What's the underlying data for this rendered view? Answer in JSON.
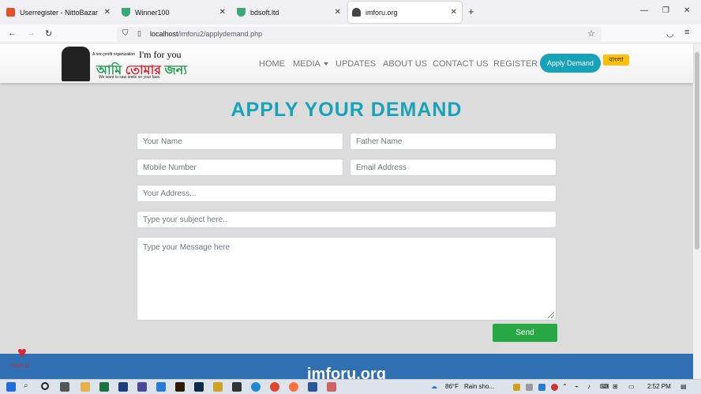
{
  "browser": {
    "tabs": [
      {
        "title": "Userregister - NittoBazar",
        "favicon_color": "#e3512b"
      },
      {
        "title": "Winner100",
        "favicon_color": "#3aa87a"
      },
      {
        "title": "bdsoft.ltd",
        "favicon_color": "#3aa87a"
      },
      {
        "title": "imforu.org",
        "favicon_color": "#444444"
      }
    ],
    "url_host": "localhost",
    "url_path": "/imforu2/applydemand.php"
  },
  "site": {
    "logo": {
      "tagline": "A non profit organization",
      "english": "I'm for you",
      "bangla_part1": "আমি ",
      "bangla_part2": "তোমার",
      "bangla_part3": " জন্য",
      "slogan": "We want to saw smile on your face."
    },
    "nav": [
      "HOME",
      "MEDIA",
      "UPDATES",
      "ABOUT US",
      "CONTACT US",
      "REGISTER"
    ],
    "apply_button": "Apply Demand",
    "language_button": "বাংলা",
    "title": "APPLY YOUR DEMAND",
    "form": {
      "name_placeholder": "Your Name",
      "father_placeholder": "Father Name",
      "mobile_placeholder": "Mobile Number",
      "email_placeholder": "Email Address",
      "address_placeholder": "Your Address...",
      "subject_placeholder": "Type your subject here..",
      "message_placeholder": "Type your Message here",
      "send_label": "Send"
    },
    "footer_title": "imforu.org",
    "heart_label": "I love U"
  },
  "taskbar": {
    "weather_temp": "86°F",
    "weather_desc": "Rain sho...",
    "time": "2:52 PM"
  },
  "colors": {
    "accent": "#17a2b8",
    "send": "#28a745",
    "language": "#ffc107",
    "footer": "#2f6fb2"
  }
}
